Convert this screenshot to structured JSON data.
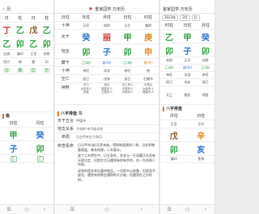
{
  "left": {
    "title": "历",
    "header": [
      "日",
      "柱",
      "日",
      "柱"
    ],
    "big_rows": [
      [
        "丁",
        "乙",
        "戊",
        "乙"
      ],
      [
        "乙",
        "卯",
        "乙",
        "卯"
      ]
    ],
    "sub_rows": [
      [
        "比肩",
        "偏印",
        "正官",
        "劫财"
      ],
      [
        "阳刃",
        "禄",
        "墓",
        "印"
      ]
    ],
    "dong_row": [
      "己",
      "庚",
      "乙",
      "丁"
    ],
    "sec": "格",
    "lower_header": [
      "日柱",
      "月柱"
    ],
    "lower_big": [
      [
        "甲",
        "癸"
      ],
      [
        "子",
        "卯"
      ]
    ],
    "lower_sub": [
      [
        "乙",
        "乙"
      ]
    ]
  },
  "mid": {
    "app_title": "重家园学-万年历",
    "cols": [
      "日柱",
      "年柱",
      "月柱",
      "日柱",
      "时柱"
    ],
    "row_labels": [
      "十神",
      "天干",
      "地支",
      "藏干",
      "十神",
      "空亡",
      "神煞"
    ],
    "shishen": [
      "",
      "正印",
      "劫财",
      "日主",
      "偏财"
    ],
    "tiangan": [
      "",
      "癸",
      "丽",
      "甲",
      "庚"
    ],
    "dizhi": [
      "",
      "卯",
      "子",
      "卯",
      "申"
    ],
    "canggan": [
      "",
      "乙(劫)",
      "癸(印)",
      "乙(劫)",
      "庚(杀)"
    ],
    "zhishen": [
      "",
      "帝旺",
      "沐浴",
      "帝旺",
      "绝"
    ],
    "kongwang": [
      "",
      "辰巳",
      "戌亥",
      "辰巳",
      "石榴木"
    ],
    "shensha_cols": [
      [
        "羊刃",
        "太极贵人",
        "将星"
      ],
      [
        "桃花",
        "福星贵人",
        "文昌贵人"
      ],
      [
        "天乙贵人",
        "天德贵人",
        "月德贵人"
      ],
      [
        "天德合",
        "太极贵人",
        "福星贵人"
      ]
    ],
    "bazi_label": "八字排盘",
    "bazi_value": "陈",
    "detail_items": [
      {
        "label": "天干五合",
        "value": "甲庚冲"
      },
      {
        "label": "地支关系",
        "value": "子卯刑 申子辰半合"
      },
      {
        "label": "命局",
        "value": "日主甲木生于卯月"
      }
    ],
    "para_label": "命查看命",
    "paragraphs": [
      "日元甲木(或)天家亲戚，得财地遥杨财人称，当年财物喜相逢，难有财源，二木喜水。",
      "癸丁之木得生中，日主身旺。非会元一生深藏正在吾有天赋注定，但是在主见遇到有财有余财，在一生的贵人扶助。",
      "读到的是非常丰富的物品。一切家中心依靠，但是身不虚也，遇到有财物金遇财的大方者，但遇到在之内的财。"
    ]
  },
  "right": {
    "title": "宙家园学-万年历",
    "date_a": "2023年",
    "date_b": "2月",
    "date_c": "日",
    "cols": [
      "时柱",
      "日柱",
      "月柱"
    ],
    "big_rows": [
      [
        "乙",
        "甲",
        "癸"
      ],
      [
        "卯",
        "子",
        "卯"
      ]
    ],
    "sub_rows": [
      [
        "劫财",
        "正印",
        "劫财"
      ],
      [
        "乙(劫)",
        "癸(印)",
        "乙(劫)"
      ]
    ],
    "misc": [
      "帝旺",
      "沐浴",
      "帝旺"
    ],
    "kong": [
      "辰巳",
      "戌亥",
      "辰巳"
    ],
    "sha": [
      "天乙",
      "桃花",
      "将星"
    ],
    "sec": "八字排盘",
    "lower_header": [
      "月柱",
      "日柱"
    ],
    "lower_big": [
      [
        "戊",
        "辛"
      ],
      [
        "卯",
        "亥"
      ]
    ],
    "lower_sub": [
      [
        "正官",
        "正印"
      ],
      [
        "偏印",
        "食神"
      ]
    ]
  }
}
